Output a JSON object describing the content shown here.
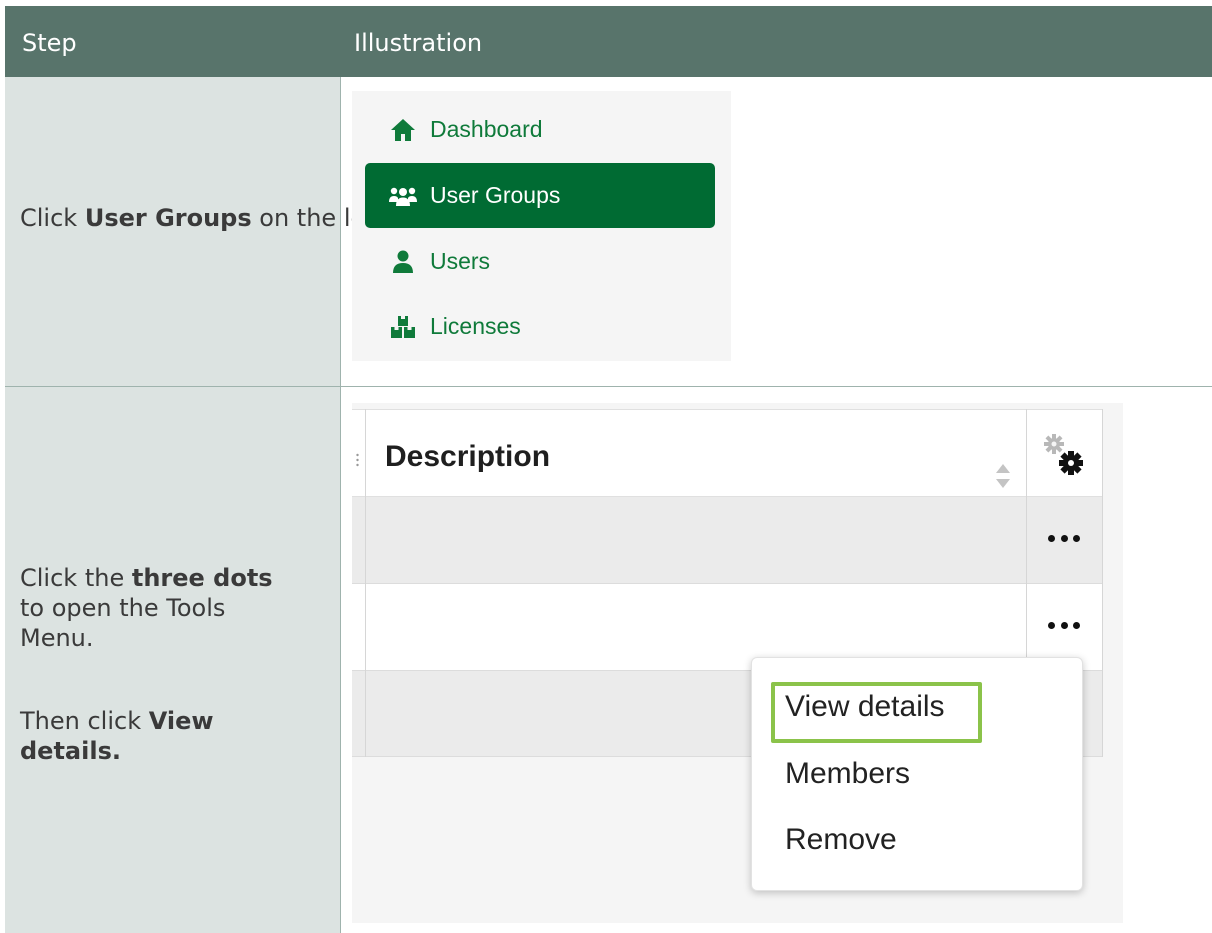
{
  "header": {
    "step": "Step",
    "illustration": "Illustration"
  },
  "step1": {
    "text_before": "Click ",
    "text_bold": "User Groups",
    "text_after": " on the left menu."
  },
  "step2": {
    "text_1": "Click the ",
    "text_bold_1": "three dots",
    "text_2": " to open the Tools Menu.",
    "text_3": "Then click ",
    "text_bold_2": "View details."
  },
  "sidebar": {
    "items": [
      {
        "label": "Dashboard",
        "icon": "home-icon",
        "active": false
      },
      {
        "label": "User Groups",
        "icon": "user-groups-icon",
        "active": true
      },
      {
        "label": "Users",
        "icon": "user-icon",
        "active": false
      },
      {
        "label": "Licenses",
        "icon": "licenses-icon",
        "active": false
      }
    ]
  },
  "table": {
    "column_header": "Description",
    "icons": [
      "sort-icon",
      "settings-gear-icon",
      "more-options-icon"
    ]
  },
  "tools_menu": {
    "items": [
      "View details",
      "Members",
      "Remove"
    ],
    "highlighted": "View details"
  },
  "colors": {
    "header_bg": "#58746b",
    "step_col_bg": "#dce3e1",
    "brand_green": "#006b33",
    "highlight_border": "#8bc34a"
  }
}
